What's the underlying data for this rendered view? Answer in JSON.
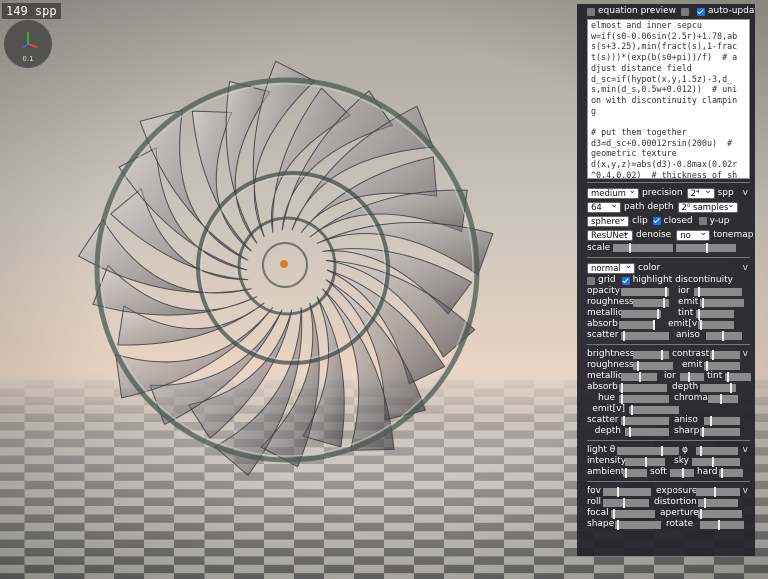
{
  "overlay": {
    "spp": "149 spp",
    "axis_scale": "0.1"
  },
  "panel": {
    "equation_preview_label": "equation preview",
    "equation_preview_checked": false,
    "auto_update_label": "auto-update",
    "auto_update_checked": true,
    "code": "elmost and inner sepcu\nw=if(s0-0.06sin(2.5r)+1.78,ab\ns(s+3.25),min(fract(s),1-frac\nt(s)))*(exp(b(s0+pi))/f)  # a\ndjust distance field\nd_sc=if(hypot(x,y,1.5z)-3,d_\ns,min(d_s,0.5w+0.012))  # uni\non with discontinuity clampin\ng\n\n# put them together\nd3=d_sc+0.00012rsin(200u)  #\ngeometric texture\nd(x,y,z)=abs(d3)-0.8max(0.02r\n^0.4,0.02)  # thickness of sh\nell",
    "render": {
      "quality": "medium",
      "precision_label": "precision",
      "spp_select": "2⁴",
      "spp_label": "spp",
      "path_depth_select": "64",
      "path_depth_label": "path depth",
      "samples_select": "2⁰ samples",
      "clip_select": "sphere",
      "clip_label": "clip",
      "closed_label": "closed",
      "closed_checked": true,
      "yup_label": "y-up",
      "yup_checked": false,
      "denoise_select": "ResUNet",
      "denoise_label": "denoise",
      "tonemap_select": "no",
      "tonemap_label": "tonemap",
      "scale_label": "scale"
    },
    "color": {
      "mode_select": "normal",
      "color_label": "color",
      "grid_label": "grid",
      "grid_checked": false,
      "highlight_label": "highlight discontinuity",
      "highlight_checked": true,
      "opacity": "opacity",
      "ior": "ior",
      "roughness": "roughness",
      "emit": "emit",
      "metallic": "metallic",
      "tint": "tint",
      "absorb": "absorb",
      "emitv": "emit[v]",
      "scatter": "scatter",
      "aniso": "aniso"
    },
    "material": {
      "brightness": "brightness",
      "contrast": "contrast",
      "roughness": "roughness",
      "emit": "emit",
      "metallic": "metallic",
      "ior": "ior",
      "tint": "tint",
      "absorb": "absorb",
      "depth": "depth",
      "hue": "hue",
      "chroma": "chroma",
      "emitv": "emit[v]",
      "scatter": "scatter",
      "aniso": "aniso",
      "depth2": "depth",
      "sharp": "sharp"
    },
    "light": {
      "theta": "light θ",
      "phi": "φ",
      "intensity": "intensity",
      "sky": "sky",
      "ambient": "ambient",
      "soft": "soft",
      "hard": "hard"
    },
    "camera": {
      "fov": "fov",
      "exposure": "exposure",
      "roll": "roll",
      "distortion": "distortion",
      "focal": "focal",
      "aperture": "aperture",
      "shape": "shape",
      "rotate": "rotate"
    }
  },
  "colors": {
    "panel_bg": "#222228",
    "accent": "#1a73e8",
    "slider": "#8a8a8a"
  }
}
